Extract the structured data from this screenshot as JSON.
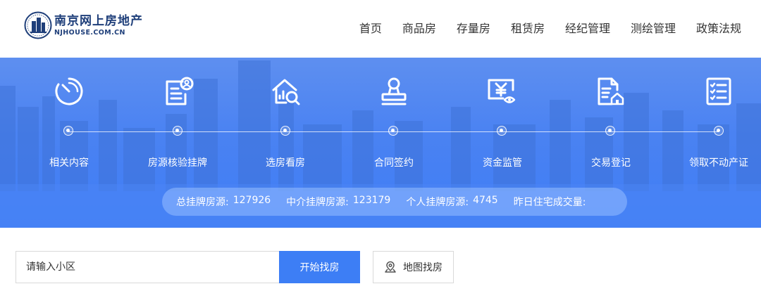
{
  "header": {
    "logo_cn": "南京网上房地产",
    "logo_en": "NJHOUSE.COM.CN",
    "nav": [
      "首页",
      "商品房",
      "存量房",
      "租赁房",
      "经纪管理",
      "测绘管理",
      "政策法规"
    ]
  },
  "steps": [
    {
      "label": "相关内容",
      "icon": "timer-icon"
    },
    {
      "label": "房源核验挂牌",
      "icon": "document-user-icon"
    },
    {
      "label": "选房看房",
      "icon": "house-search-icon"
    },
    {
      "label": "合同签约",
      "icon": "seal-stamp-icon"
    },
    {
      "label": "资金监管",
      "icon": "yen-monitor-icon"
    },
    {
      "label": "交易登记",
      "icon": "document-house-icon"
    },
    {
      "label": "领取不动产证",
      "icon": "checklist-icon"
    }
  ],
  "stats": {
    "total_label": "总挂牌房源:",
    "total_value": "127926",
    "agency_label": "中介挂牌房源:",
    "agency_value": "123179",
    "personal_label": "个人挂牌房源:",
    "personal_value": "4745",
    "yesterday_label": "昨日住宅成交量:",
    "yesterday_value": ""
  },
  "search": {
    "placeholder": "请输入小区",
    "button_label": "开始找房",
    "map_button_label": "地图找房"
  },
  "colors": {
    "brand_blue": "#3d7ef5",
    "logo_navy": "#1f3f7a"
  }
}
